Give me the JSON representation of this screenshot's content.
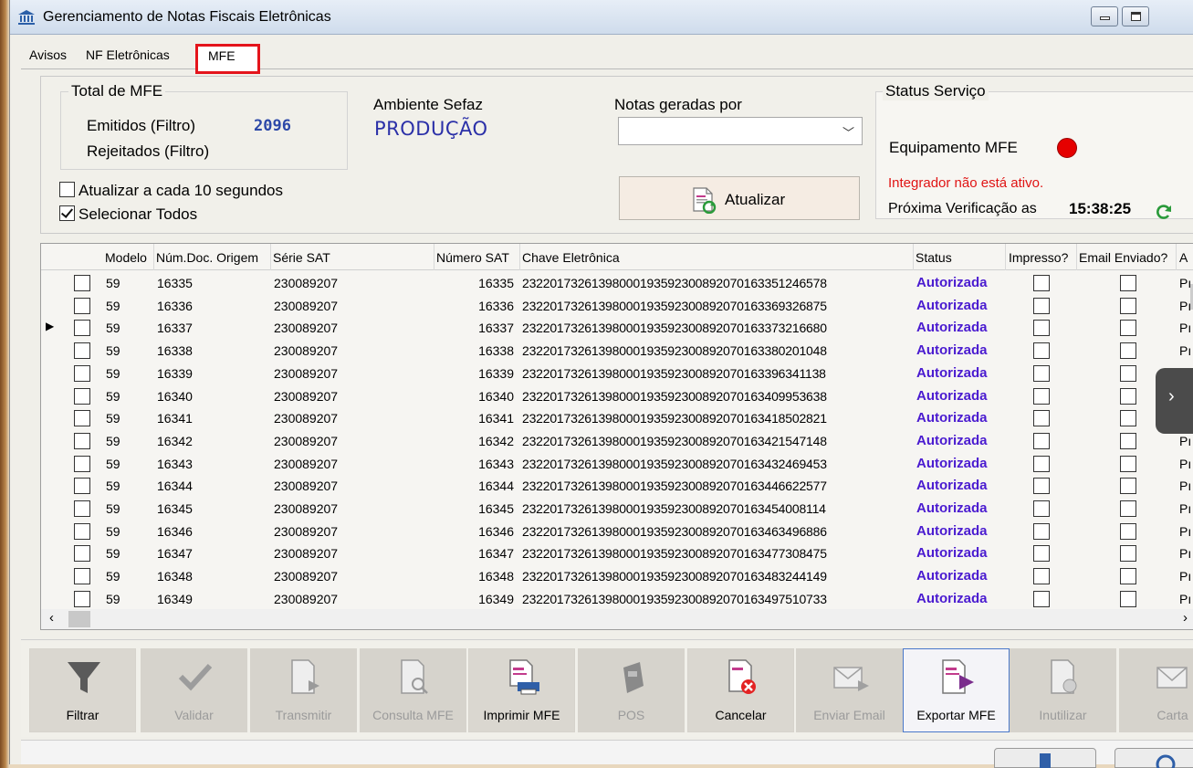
{
  "window": {
    "title": "Gerenciamento de Notas Fiscais Eletrônicas"
  },
  "tabs": [
    "Avisos",
    "NF Eletrônicas",
    "MFE"
  ],
  "active_tab": "MFE",
  "totals": {
    "title": "Total de MFE",
    "emitidos_label": "Emitidos (Filtro)",
    "emitidos_value": "2096",
    "rejeitados_label": "Rejeitados (Filtro)"
  },
  "ambiente": {
    "label": "Ambiente Sefaz",
    "value": "PRODUÇÃO"
  },
  "notas_geradas": {
    "label": "Notas geradas por",
    "selected": ""
  },
  "options": {
    "auto_update_label": "Atualizar a cada 10 segundos",
    "auto_update_checked": false,
    "select_all_label": "Selecionar Todos",
    "select_all_checked": true
  },
  "refresh_button_label": "Atualizar",
  "status_servico": {
    "title": "Status Serviço",
    "equipamento_label": "Equipamento MFE",
    "indicator_color": "#e50000",
    "error": "Integrador não está ativo.",
    "next_check_label": "Próxima Verificação as",
    "next_check_time": "15:38:25"
  },
  "grid": {
    "columns": [
      "Modelo",
      "Núm.Doc. Origem",
      "Série SAT",
      "Número SAT",
      "Chave Eletrônica",
      "Status",
      "Impresso?",
      "Email Enviado?",
      "A"
    ],
    "current_row_marker": "▶",
    "rows": [
      {
        "modelo": "59",
        "num_doc": "16335",
        "serie": "230089207",
        "numero": "16335",
        "chave": "23220173261398000193592300892070163351246578",
        "status": "Autorizada",
        "extra": "Pı"
      },
      {
        "modelo": "59",
        "num_doc": "16336",
        "serie": "230089207",
        "numero": "16336",
        "chave": "23220173261398000193592300892070163369326875",
        "status": "Autorizada",
        "extra": "Pı"
      },
      {
        "modelo": "59",
        "num_doc": "16337",
        "serie": "230089207",
        "numero": "16337",
        "chave": "23220173261398000193592300892070163373216680",
        "status": "Autorizada",
        "extra": "Pı"
      },
      {
        "modelo": "59",
        "num_doc": "16338",
        "serie": "230089207",
        "numero": "16338",
        "chave": "23220173261398000193592300892070163380201048",
        "status": "Autorizada",
        "extra": "Pı"
      },
      {
        "modelo": "59",
        "num_doc": "16339",
        "serie": "230089207",
        "numero": "16339",
        "chave": "23220173261398000193592300892070163396341138",
        "status": "Autorizada",
        "extra": ""
      },
      {
        "modelo": "59",
        "num_doc": "16340",
        "serie": "230089207",
        "numero": "16340",
        "chave": "23220173261398000193592300892070163409953638",
        "status": "Autorizada",
        "extra": ""
      },
      {
        "modelo": "59",
        "num_doc": "16341",
        "serie": "230089207",
        "numero": "16341",
        "chave": "23220173261398000193592300892070163418502821",
        "status": "Autorizada",
        "extra": ""
      },
      {
        "modelo": "59",
        "num_doc": "16342",
        "serie": "230089207",
        "numero": "16342",
        "chave": "23220173261398000193592300892070163421547148",
        "status": "Autorizada",
        "extra": "Pı"
      },
      {
        "modelo": "59",
        "num_doc": "16343",
        "serie": "230089207",
        "numero": "16343",
        "chave": "23220173261398000193592300892070163432469453",
        "status": "Autorizada",
        "extra": "Pı"
      },
      {
        "modelo": "59",
        "num_doc": "16344",
        "serie": "230089207",
        "numero": "16344",
        "chave": "23220173261398000193592300892070163446622577",
        "status": "Autorizada",
        "extra": "Pı"
      },
      {
        "modelo": "59",
        "num_doc": "16345",
        "serie": "230089207",
        "numero": "16345",
        "chave": "23220173261398000193592300892070163454008114",
        "status": "Autorizada",
        "extra": "Pı"
      },
      {
        "modelo": "59",
        "num_doc": "16346",
        "serie": "230089207",
        "numero": "16346",
        "chave": "23220173261398000193592300892070163463496886",
        "status": "Autorizada",
        "extra": "Pı"
      },
      {
        "modelo": "59",
        "num_doc": "16347",
        "serie": "230089207",
        "numero": "16347",
        "chave": "23220173261398000193592300892070163477308475",
        "status": "Autorizada",
        "extra": "Pı"
      },
      {
        "modelo": "59",
        "num_doc": "16348",
        "serie": "230089207",
        "numero": "16348",
        "chave": "23220173261398000193592300892070163483244149",
        "status": "Autorizada",
        "extra": "Pı"
      },
      {
        "modelo": "59",
        "num_doc": "16349",
        "serie": "230089207",
        "numero": "16349",
        "chave": "23220173261398000193592300892070163497510733",
        "status": "Autorizada",
        "extra": "Pı"
      }
    ]
  },
  "toolbar": [
    {
      "label": "Filtrar",
      "icon": "funnel-icon",
      "state": "enabled"
    },
    {
      "label": "Validar",
      "icon": "checkmark-icon",
      "state": "disabled"
    },
    {
      "label": "Transmitir",
      "icon": "document-send-icon",
      "state": "disabled"
    },
    {
      "label": "Consulta MFE",
      "icon": "document-search-icon",
      "state": "disabled"
    },
    {
      "label": "Imprimir MFE",
      "icon": "printer-icon",
      "state": "enabled"
    },
    {
      "label": "POS",
      "icon": "pos-terminal-icon",
      "state": "disabled"
    },
    {
      "label": "Cancelar",
      "icon": "document-cancel-icon",
      "state": "enabled"
    },
    {
      "label": "Enviar Email",
      "icon": "email-send-icon",
      "state": "disabled"
    },
    {
      "label": "Exportar MFE",
      "icon": "document-export-icon",
      "state": "focused"
    },
    {
      "label": "Inutilizar",
      "icon": "document-void-icon",
      "state": "disabled"
    },
    {
      "label": "Carta",
      "icon": "letter-icon",
      "state": "disabled"
    }
  ]
}
